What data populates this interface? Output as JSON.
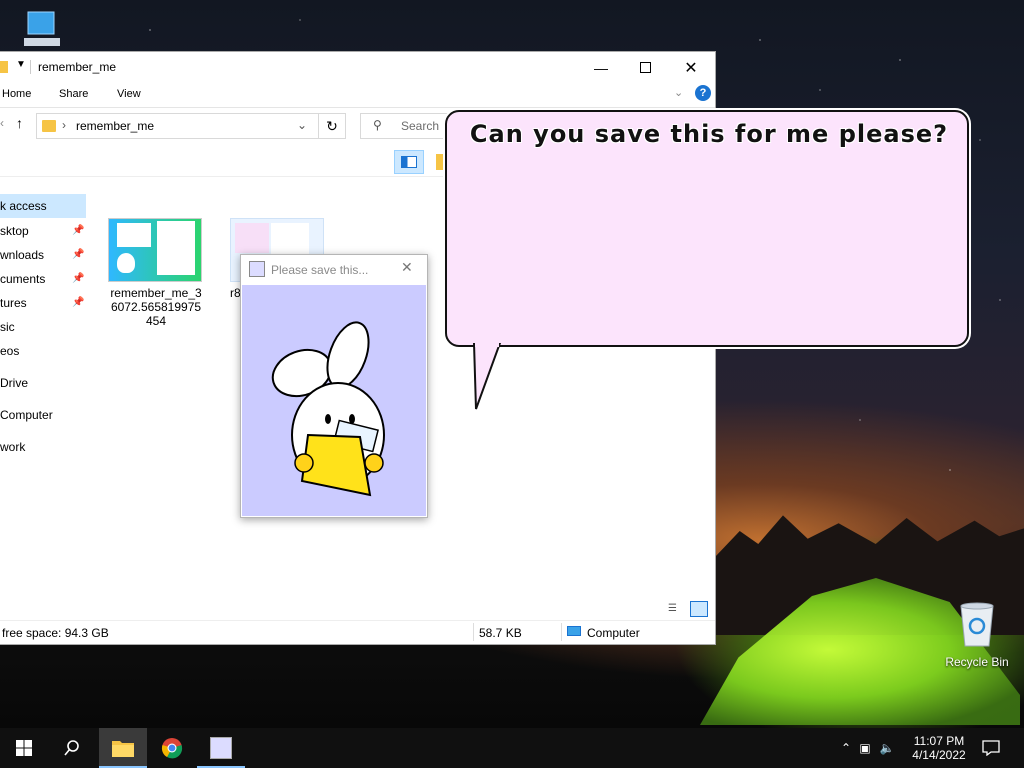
{
  "desktop": {
    "recycle_bin_label": "Recycle Bin"
  },
  "explorer": {
    "title": "remember_me",
    "ribbon_tabs": [
      "Home",
      "Share",
      "View"
    ],
    "address": "remember_me",
    "search_placeholder": "Search r",
    "nav_items": [
      {
        "label": "k access",
        "pinned": false,
        "selected": true
      },
      {
        "label": "sktop",
        "pinned": true,
        "selected": false
      },
      {
        "label": "wnloads",
        "pinned": true,
        "selected": false
      },
      {
        "label": "cuments",
        "pinned": true,
        "selected": false
      },
      {
        "label": "tures",
        "pinned": true,
        "selected": false
      },
      {
        "label": "sic",
        "pinned": false,
        "selected": false
      },
      {
        "label": "eos",
        "pinned": false,
        "selected": false
      },
      {
        "label": "Drive",
        "pinned": false,
        "selected": false
      },
      {
        "label": "Computer",
        "pinned": false,
        "selected": false
      },
      {
        "label": "work",
        "pinned": false,
        "selected": false
      }
    ],
    "files": [
      {
        "name": "remember_me_36072.565819975454"
      },
      {
        "name": "r8"
      }
    ],
    "status": {
      "free_space": "free space: 94.3 GB",
      "size": "58.7 KB",
      "location": "Computer"
    }
  },
  "dialog": {
    "title": "Please save this..."
  },
  "bubble": {
    "text": "Can you save this for me please?"
  },
  "taskbar": {
    "time": "11:07 PM",
    "date": "4/14/2022"
  },
  "colors": {
    "bubble_bg": "#fce4fc",
    "dialog_bg": "#cbcbff",
    "selection": "#cce8ff",
    "taskbar": "#101010"
  }
}
